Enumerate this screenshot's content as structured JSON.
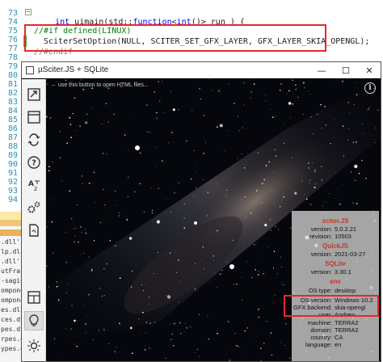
{
  "editor": {
    "line_numbers": [
      "73",
      "74",
      "75",
      "76",
      "77",
      "78",
      "79",
      "80",
      "81",
      "82",
      "83",
      "84",
      "85",
      "86",
      "87",
      "88",
      "89",
      "90",
      "91",
      "92",
      "93",
      "94"
    ],
    "line_func": {
      "kw1": "int",
      "name": " uimain(std::",
      "kw2": "function",
      "lt": "<",
      "kw3": "int",
      "rest": "()> run ) {"
    },
    "line_ifdef": "//#if defined(LINUX)",
    "line_call": "SciterSetOption(NULL, SCITER_SET_GFX_LAYER, GFX_LAYER_SKIA_OPENGL);",
    "line_endif": "//#endif",
    "collapse_glyph": "−"
  },
  "output_panel": {
    "lines": [
      ".dll'.",
      "lp.dl",
      ".dll'.",
      "utFra",
      "-sagin",
      "ompone",
      "ompone",
      "es.dll",
      "ces.dl",
      "pes.dl",
      "rpes.d",
      "ypes.dll"
    ]
  },
  "window": {
    "title": "µSciter.JS + SQLite",
    "minimize": "—",
    "maximize": "☐",
    "close": "✕"
  },
  "toolbar": {
    "icons": [
      "open-file-icon",
      "window-icon",
      "reload-icon",
      "help-icon",
      "translate-icon",
      "settings-gears-icon",
      "pdf-document-icon",
      "layout-grid-icon",
      "lightbulb-icon",
      "sun-icon"
    ]
  },
  "content": {
    "hint": "← use this button to open HTML files...",
    "info_glyph": "i"
  },
  "info": {
    "sciter_title": "sciter.JS",
    "version_label": "version:",
    "version_value": "5.0.2.21",
    "revision_label": "revision:",
    "revision_value": "10503",
    "quickjs_title": "QuickJS",
    "qjs_version_label": "version:",
    "qjs_version_value": "2021-03-27",
    "sqlite_title": "SQLite",
    "sqlite_version_label": "version:",
    "sqlite_version_value": "3.30.1",
    "env_title": "env",
    "os_type_label": "OS type:",
    "os_type_value": "desktop",
    "os_version_label": "OS version:",
    "os_version_value": "Windows-10.2",
    "gfx_label": "GFX backend:",
    "gfx_value": "skia-opengl",
    "user_label": "user:",
    "user_value": "Andrew",
    "machine_label": "machine:",
    "machine_value": "TERRA2",
    "domain_label": "domain:",
    "domain_value": "TERRA2",
    "country_label": "country:",
    "country_value": "CA",
    "language_label": "language:",
    "language_value": "en"
  },
  "colors": {
    "highlight_box": "#e8262c",
    "section_title": "#c0392b",
    "line_number": "#2b91af",
    "keyword": "#0000ff",
    "comment": "#008000"
  }
}
